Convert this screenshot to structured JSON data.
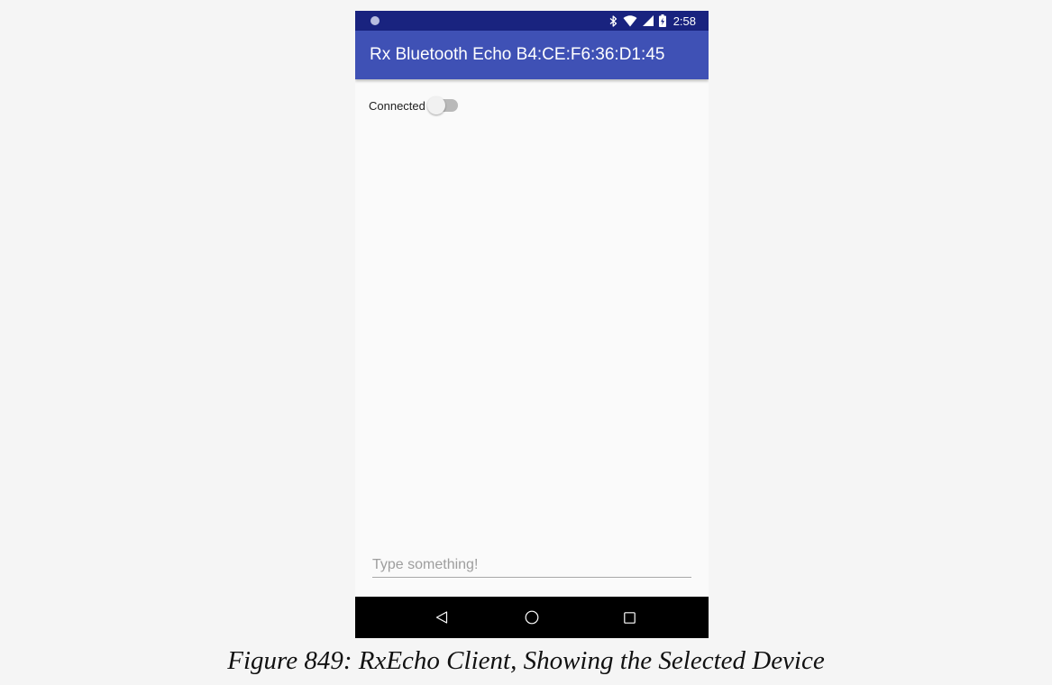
{
  "status_bar": {
    "time": "2:58",
    "icons": [
      "notification-dot-icon",
      "bluetooth-icon",
      "wifi-icon",
      "signal-icon",
      "battery-charging-icon"
    ]
  },
  "app_bar": {
    "title": "Rx Bluetooth Echo B4:CE:F6:36:D1:45",
    "color": "#3f51b5",
    "status_color": "#19237f"
  },
  "connection": {
    "label": "Connected",
    "on": false
  },
  "message_input": {
    "placeholder": "Type something!",
    "value": ""
  },
  "nav_bar": {
    "icons": [
      "back-icon",
      "home-icon",
      "recents-icon"
    ]
  },
  "caption": "Figure 849: RxEcho Client, Showing the Selected Device"
}
